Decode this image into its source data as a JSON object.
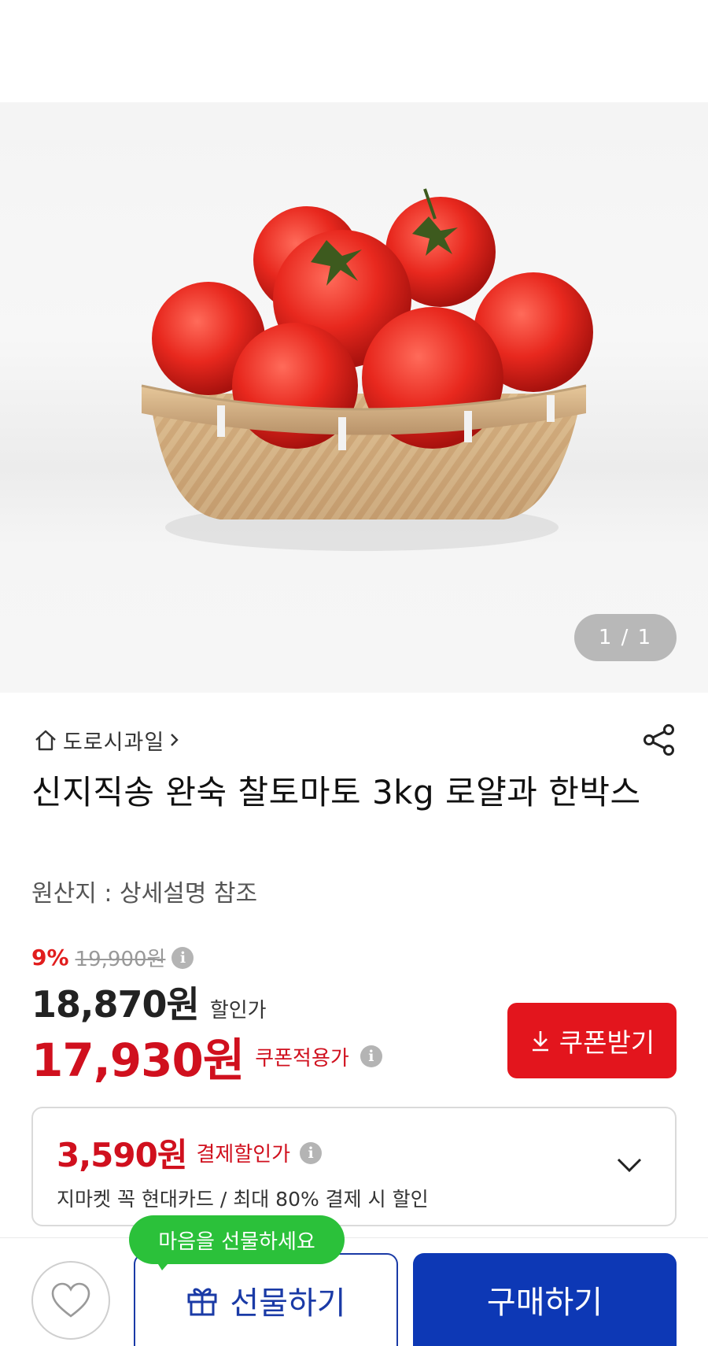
{
  "product": {
    "image_pager": "1 / 1",
    "store_name": "도로시과일",
    "title": "신지직송 완숙 찰토마토 3kg 로얄과 한박스",
    "origin": "원산지 : 상세설명 참조"
  },
  "pricing": {
    "discount_pct": "9%",
    "original_price": "19,900원",
    "sale_price": "18,870원",
    "sale_label": "할인가",
    "coupon_price": "17,930원",
    "coupon_label": "쿠폰적용가",
    "coupon_button": "쿠폰받기",
    "info_glyph": "i"
  },
  "card_offer": {
    "price": "3,590원",
    "label": "결제할인가",
    "description": "지마켓 꼭 현대카드 / 최대 80% 결제 시 할인"
  },
  "bottom_bar": {
    "tooltip": "마음을 선물하세요",
    "gift_button": "선물하기",
    "buy_button": "구매하기"
  },
  "colors": {
    "accent_red": "#e3151d",
    "price_red": "#d0101e",
    "buy_blue": "#0d38b5",
    "tooltip_green": "#2bc13a"
  },
  "icons": [
    "home-icon",
    "chevron-right-icon",
    "share-icon",
    "info-icon",
    "download-icon",
    "chevron-down-icon",
    "heart-icon",
    "gift-icon"
  ]
}
